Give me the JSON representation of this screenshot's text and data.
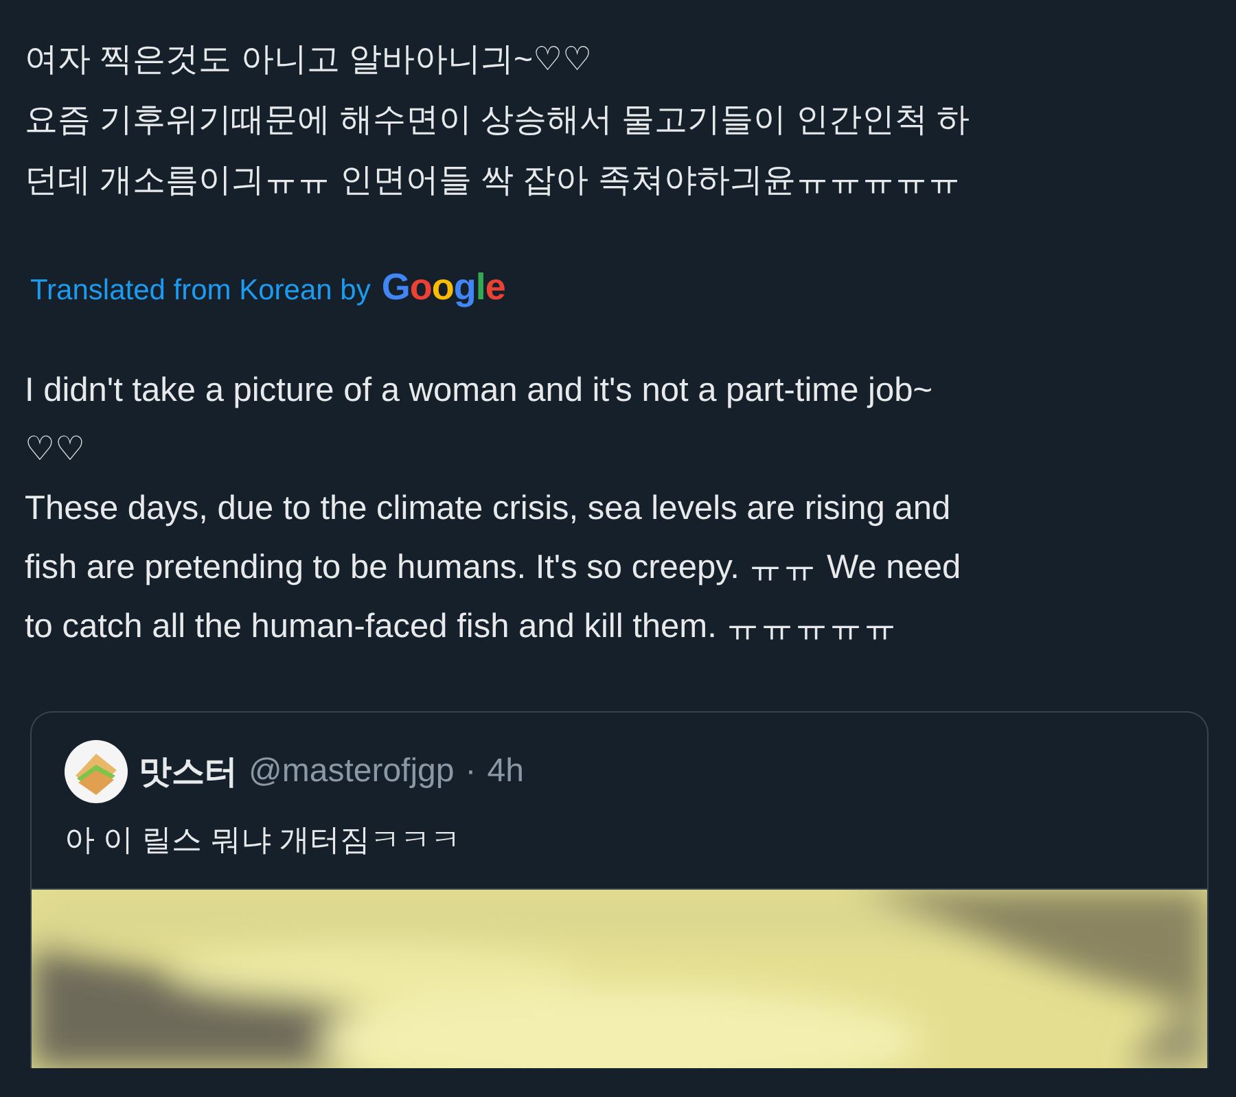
{
  "original_lines": [
    "여자 찍은것도 아니고 알바아니긔~♡♡",
    "요즘 기후위기때문에 해수면이 상승해서 물고기들이 인간인척 하",
    "던데 개소름이긔ㅠㅠ 인면어들 싹 잡아 족쳐야하긔윤ㅠㅠㅠㅠㅠ"
  ],
  "translation_note": {
    "label": "Translated from Korean by",
    "brand": "Google"
  },
  "translated_lines": [
    "I didn't take a picture of a woman and it's not a part-time job~",
    "♡♡",
    "These days, due to the climate crisis, sea levels are rising and",
    "fish are pretending to be humans. It's so creepy. ㅠㅠ We need",
    "to catch all the human-faced fish and kill them. ㅠㅠㅠㅠㅠ"
  ],
  "quoted_post": {
    "display_name": "맛스터",
    "handle": "@masterofjgp",
    "separator": "·",
    "time": "4h",
    "text": "아 이 릴스 뭐냐 개터짐ㅋㅋㅋ"
  }
}
